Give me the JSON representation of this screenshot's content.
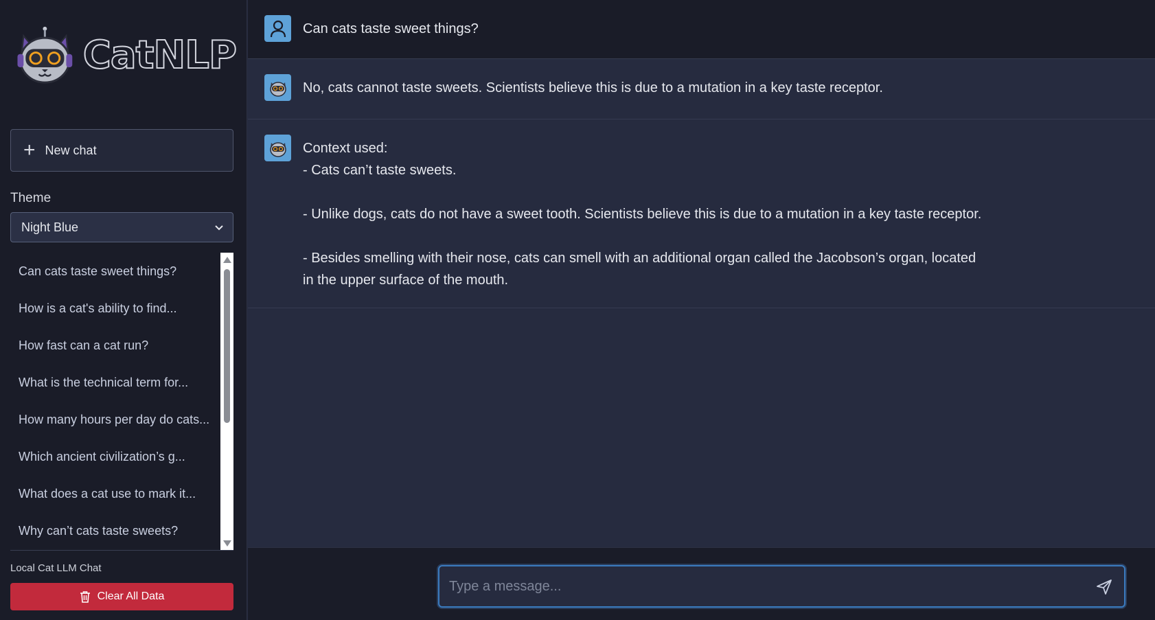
{
  "app": {
    "name": "CatNLP"
  },
  "sidebar": {
    "new_chat_label": "New chat",
    "theme_label": "Theme",
    "theme_value": "Night Blue",
    "history": [
      "Can cats taste sweet things?",
      "How is a cat's ability to find...",
      "How fast can a cat run?",
      "What is the technical term for...",
      "How many hours per day do cats...",
      "Which ancient civilization’s g...",
      "What does a cat use to mark it...",
      "Why can’t cats taste sweets?"
    ],
    "footer_label": "Local Cat LLM Chat",
    "clear_label": "Clear All Data"
  },
  "chat": {
    "user_message": "Can cats taste sweet things?",
    "bot_answer": "No, cats cannot taste sweets. Scientists believe this is due to a mutation in a key taste receptor.",
    "context_title": "Context used:",
    "context_items": [
      "- Cats can’t taste sweets.",
      "- Unlike dogs, cats do not have a sweet tooth. Scientists believe this is due to a mutation in a key taste receptor.",
      "- Besides smelling with their nose, cats can smell with an additional organ called the Jacobson’s organ, located in the upper surface of the mouth."
    ]
  },
  "input": {
    "placeholder": "Type a message..."
  },
  "colors": {
    "sidebar_bg": "#1a1c28",
    "main_bg": "#262b3f",
    "accent": "#5ea2d8",
    "danger": "#c22a3c",
    "input_border": "#3a7bbf"
  }
}
